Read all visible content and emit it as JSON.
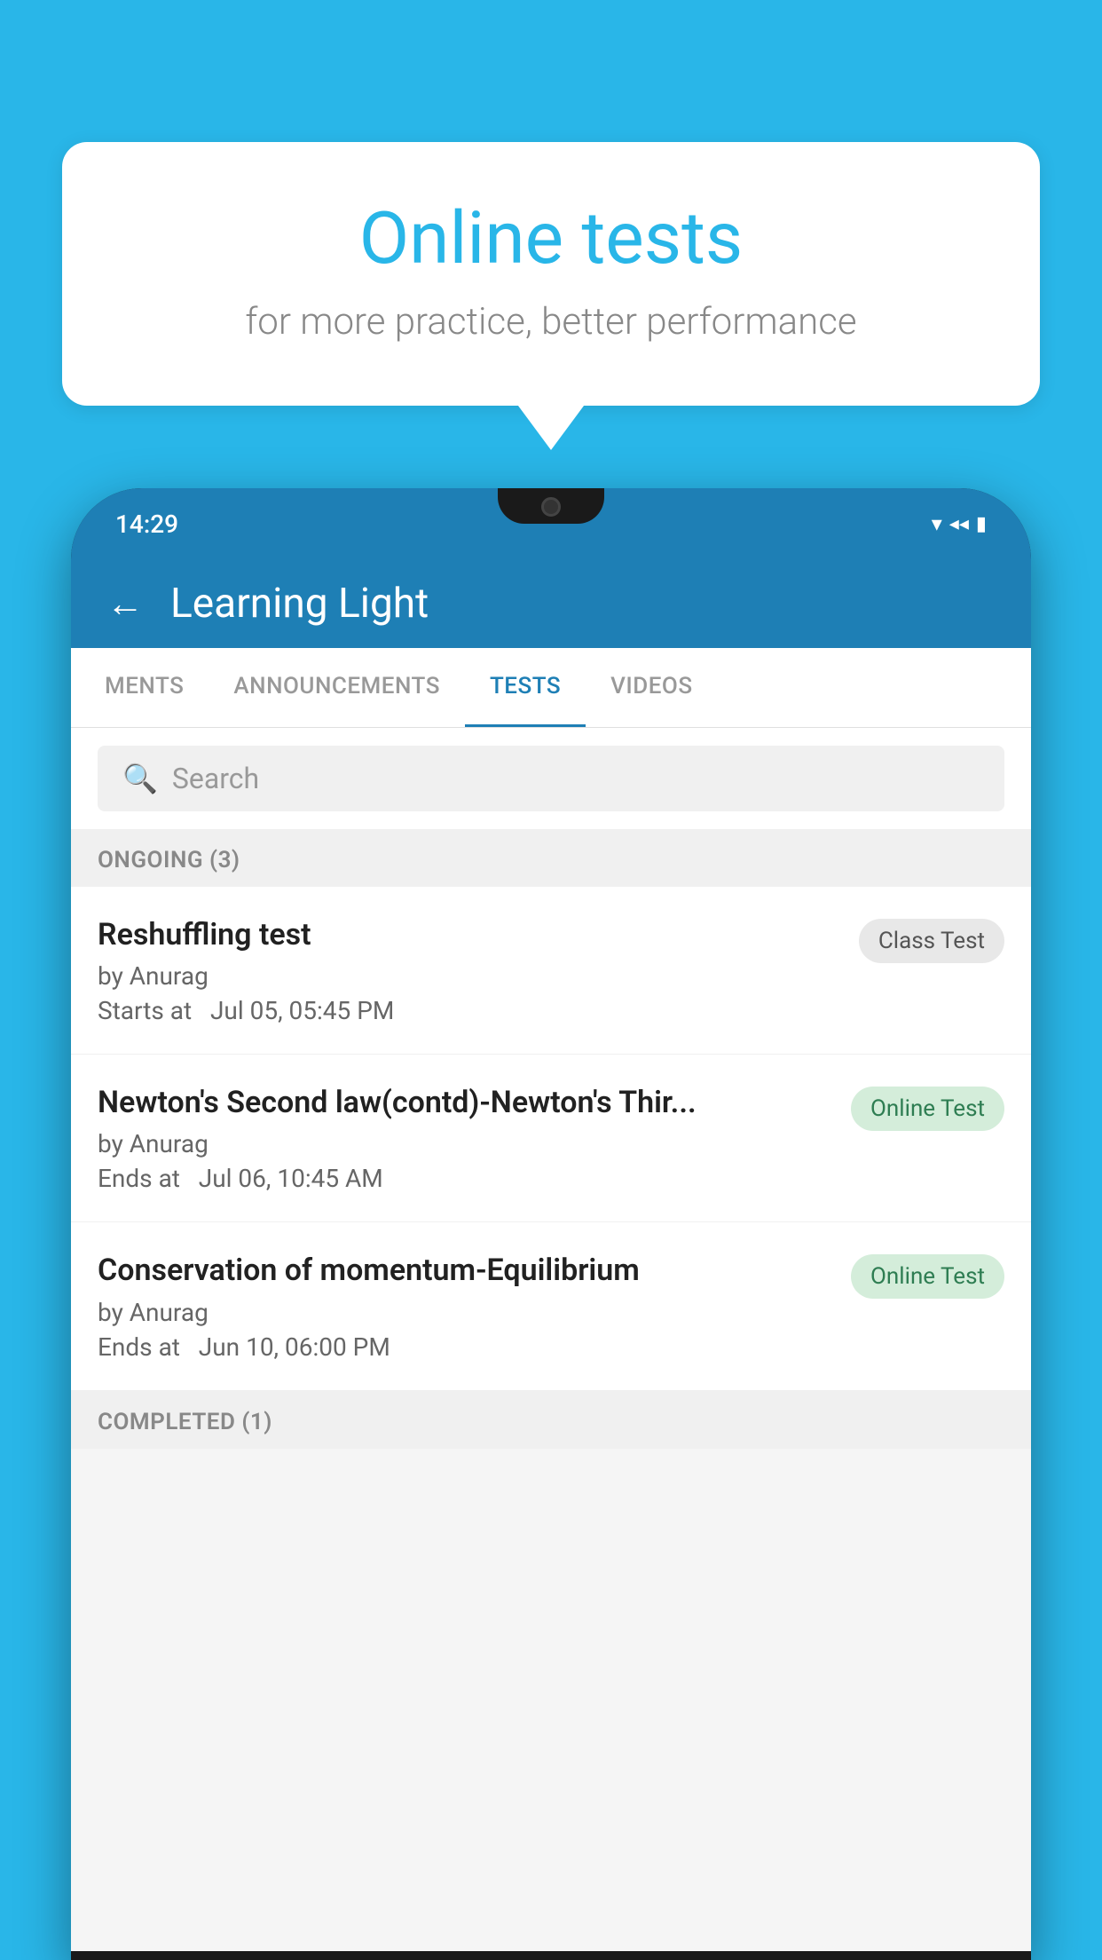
{
  "background_color": "#29b6e8",
  "bubble": {
    "title": "Online tests",
    "subtitle": "for more practice, better performance"
  },
  "phone": {
    "status_bar": {
      "time": "14:29",
      "icons": [
        "wifi",
        "signal",
        "battery"
      ]
    },
    "header": {
      "title": "Learning Light",
      "back_label": "←"
    },
    "tabs": [
      {
        "label": "MENTS",
        "active": false
      },
      {
        "label": "ANNOUNCEMENTS",
        "active": false
      },
      {
        "label": "TESTS",
        "active": true
      },
      {
        "label": "VIDEOS",
        "active": false
      }
    ],
    "search": {
      "placeholder": "Search"
    },
    "sections": [
      {
        "id": "ongoing",
        "header": "ONGOING (3)",
        "tests": [
          {
            "name": "Reshuffling test",
            "author": "by Anurag",
            "time_label": "Starts at",
            "time": "Jul 05, 05:45 PM",
            "badge": "Class Test",
            "badge_type": "class"
          },
          {
            "name": "Newton's Second law(contd)-Newton's Thir...",
            "author": "by Anurag",
            "time_label": "Ends at",
            "time": "Jul 06, 10:45 AM",
            "badge": "Online Test",
            "badge_type": "online"
          },
          {
            "name": "Conservation of momentum-Equilibrium",
            "author": "by Anurag",
            "time_label": "Ends at",
            "time": "Jun 10, 06:00 PM",
            "badge": "Online Test",
            "badge_type": "online"
          }
        ]
      },
      {
        "id": "completed",
        "header": "COMPLETED (1)",
        "tests": []
      }
    ]
  }
}
